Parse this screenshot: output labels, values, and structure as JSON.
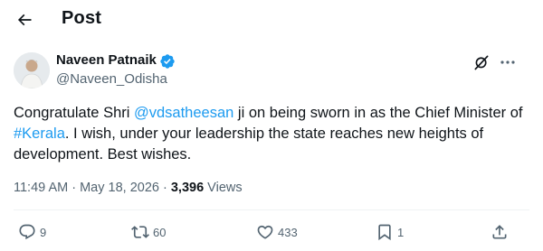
{
  "header": {
    "title": "Post"
  },
  "tweet": {
    "author_name": "Naveen Patnaik",
    "handle": "@Naveen_Odisha",
    "text_parts": {
      "p1": "Congratulate Shri ",
      "mention": "@vdsatheesan",
      "p2": " ji on being sworn in as the Chief Minister of ",
      "hashtag": "#Kerala",
      "p3": ". I wish, under your leadership the state reaches new heights of development. Best wishes."
    },
    "time": "11:49 AM",
    "separator1": " · ",
    "date": "May 18, 2026",
    "separator2": " · ",
    "views_count": "3,396",
    "views_label": " Views"
  },
  "actions": {
    "replies": "9",
    "reposts": "60",
    "likes": "433",
    "bookmarks": "1"
  },
  "colors": {
    "link": "#1d9bf0",
    "verified": "#1d9bf0",
    "secondary_text": "#536471",
    "primary_text": "#0f1419"
  },
  "icons": [
    "back-arrow-icon",
    "verified-badge-icon",
    "grok-icon",
    "more-icon",
    "reply-icon",
    "retweet-icon",
    "like-icon",
    "bookmark-icon",
    "share-icon"
  ]
}
